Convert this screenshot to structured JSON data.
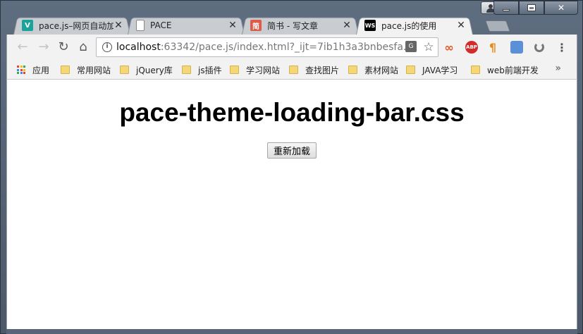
{
  "window": {
    "controls": {
      "minimize": "—",
      "maximize": "□",
      "close": "✕"
    }
  },
  "tabs": [
    {
      "title": "pace.js–网页自动加",
      "icon": "tab-favicon-v",
      "icon_color": "#1aa39a",
      "icon_glyph": "V",
      "active": false
    },
    {
      "title": "PACE",
      "icon": "page-icon",
      "icon_color": "#ffffff",
      "icon_glyph": "",
      "active": false
    },
    {
      "title": "简书 - 写文章",
      "icon": "jianshu-icon",
      "icon_color": "#e05a48",
      "icon_glyph": "简",
      "active": false
    },
    {
      "title": "pace.js的使用",
      "icon": "webstorm-icon",
      "icon_color": "#000000",
      "icon_glyph": "WS",
      "active": true
    }
  ],
  "toolbar": {
    "url_host": "localhost",
    "url_rest": ":63342/pace.js/index.html?_ijt=7ib1h3a3bnbesfa...",
    "back": "←",
    "forward": "→",
    "reload": "↻",
    "home": "⌂",
    "star": "☆",
    "menu": "⋮"
  },
  "bookmarks": {
    "apps_label": "应用",
    "items": [
      "常用网站",
      "jQuery库",
      "js插件",
      "学习网站",
      "查找图片",
      "素材网站",
      "JAVA学习",
      "web前端开发"
    ],
    "more": "»"
  },
  "page": {
    "heading": "pace-theme-loading-bar.css",
    "reload_button": "重新加载"
  },
  "colors": {
    "frame": "#525e6e",
    "folder": "#f6d776",
    "active_tab": "#f2f2f2"
  }
}
